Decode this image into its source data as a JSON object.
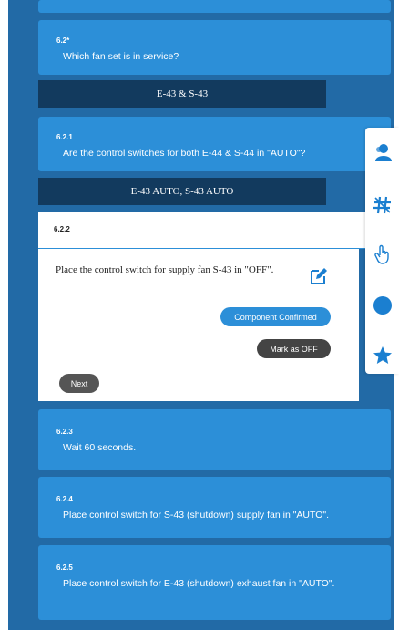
{
  "steps": {
    "s1": {
      "num": "6.2*",
      "text": "Which fan set is in service?",
      "answer": "E-43 & S-43"
    },
    "s2": {
      "num": "6.2.1",
      "text": "Are the control switches for both E-44 & S-44 in \"AUTO\"?",
      "answer": "E-43 AUTO, S-43 AUTO"
    },
    "s3": {
      "num": "6.2.2",
      "text": "Place the control switch for supply fan S-43 in \"OFF\"."
    },
    "s4": {
      "num": "6.2.3",
      "text": "Wait 60 seconds."
    },
    "s5": {
      "num": "6.2.4",
      "text": "Place control switch for S-43 (shutdown) supply fan in \"AUTO\"."
    },
    "s6": {
      "num": "6.2.5",
      "text": "Place control switch for E-43 (shutdown) exhaust fan in \"AUTO\"."
    }
  },
  "actions": {
    "confirm": "Component Confirmed",
    "mark_off": "Mark as OFF",
    "next": "Next"
  },
  "side_tools": [
    "person-icon",
    "hashtag-icon",
    "hand-pointer-icon",
    "circle-icon",
    "star-icon"
  ],
  "colors": {
    "frame": "#226aa6",
    "card": "#2c8fd8",
    "answer_bar": "#123a5e",
    "icon": "#1b7fd0",
    "mark_button": "#444444"
  }
}
